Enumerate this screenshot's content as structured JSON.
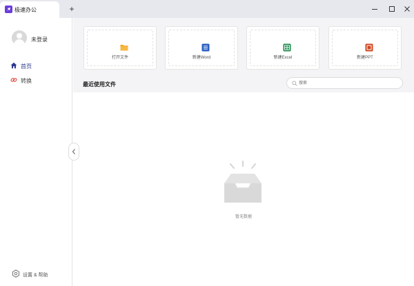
{
  "app": {
    "tab_title": "极速办公",
    "new_tab_label": "+"
  },
  "sidebar": {
    "user_name": "未登录",
    "nav": [
      {
        "label": "首页",
        "icon": "home-icon"
      },
      {
        "label": "转换",
        "icon": "link-icon"
      }
    ],
    "settings_label": "设置 & 帮助"
  },
  "quick_actions": [
    {
      "label": "打开文件",
      "icon": "folder-icon",
      "color": "#f5a623"
    },
    {
      "label": "新建Word",
      "icon": "word-icon",
      "color": "#2b5fc4"
    },
    {
      "label": "新建Excel",
      "icon": "excel-icon",
      "color": "#1f8a4c"
    },
    {
      "label": "新建PPT",
      "icon": "ppt-icon",
      "color": "#d0461f"
    }
  ],
  "recent": {
    "title": "最近使用文件",
    "search_placeholder": "搜索",
    "empty_text": "暂无数据"
  },
  "colors": {
    "accent": "#2d3a8c",
    "brand": "#6a3ed9",
    "titlebar": "#e6e8ee",
    "main_bg": "#f4f4f6"
  }
}
